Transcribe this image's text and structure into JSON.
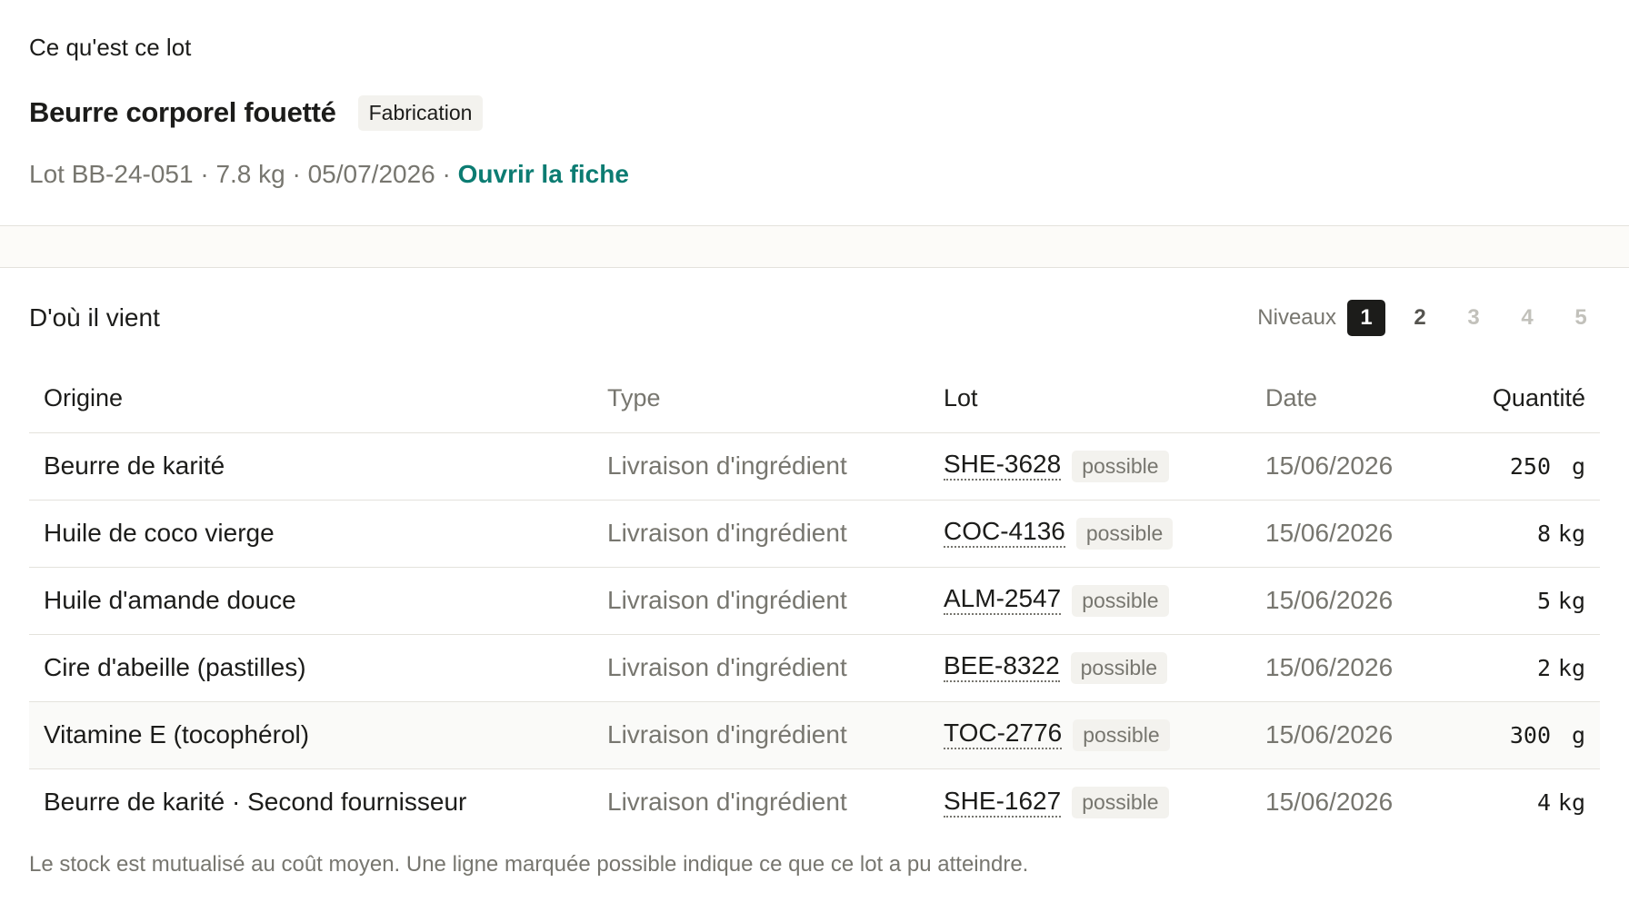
{
  "summary": {
    "heading": "Ce qu'est ce lot",
    "product_name": "Beurre corporel fouetté",
    "kind_badge": "Fabrication",
    "meta": "Lot BB-24-051 · 7.8 kg · 05/07/2026 · ",
    "open_link": "Ouvrir la fiche"
  },
  "origin": {
    "heading": "D'où il vient",
    "levels_label": "Niveaux",
    "levels": [
      {
        "label": "1",
        "state": "active"
      },
      {
        "label": "2",
        "state": "enabled"
      },
      {
        "label": "3",
        "state": "disabled"
      },
      {
        "label": "4",
        "state": "disabled"
      },
      {
        "label": "5",
        "state": "disabled"
      }
    ],
    "columns": [
      "Origine",
      "Type",
      "Lot",
      "Date",
      "Quantité"
    ],
    "rows": [
      {
        "origin": "Beurre de karité",
        "type": "Livraison d'ingrédient",
        "lot": "SHE-3628",
        "badge": "possible",
        "date": "15/06/2026",
        "qty": "250",
        "unit": "g"
      },
      {
        "origin": "Huile de coco vierge",
        "type": "Livraison d'ingrédient",
        "lot": "COC-4136",
        "badge": "possible",
        "date": "15/06/2026",
        "qty": "8",
        "unit": "kg"
      },
      {
        "origin": "Huile d'amande douce",
        "type": "Livraison d'ingrédient",
        "lot": "ALM-2547",
        "badge": "possible",
        "date": "15/06/2026",
        "qty": "5",
        "unit": "kg"
      },
      {
        "origin": "Cire d'abeille (pastilles)",
        "type": "Livraison d'ingrédient",
        "lot": "BEE-8322",
        "badge": "possible",
        "date": "15/06/2026",
        "qty": "2",
        "unit": "kg"
      },
      {
        "origin": "Vitamine E (tocophérol)",
        "type": "Livraison d'ingrédient",
        "lot": "TOC-2776",
        "badge": "possible",
        "date": "15/06/2026",
        "qty": "300",
        "unit": "g"
      },
      {
        "origin": "Beurre de karité · Second fournisseur",
        "type": "Livraison d'ingrédient",
        "lot": "SHE-1627",
        "badge": "possible",
        "date": "15/06/2026",
        "qty": "4",
        "unit": "kg"
      }
    ],
    "footnote": "Le stock est mutualisé au coût moyen. Une ligne marquée possible indique ce que ce lot a pu atteindre."
  }
}
